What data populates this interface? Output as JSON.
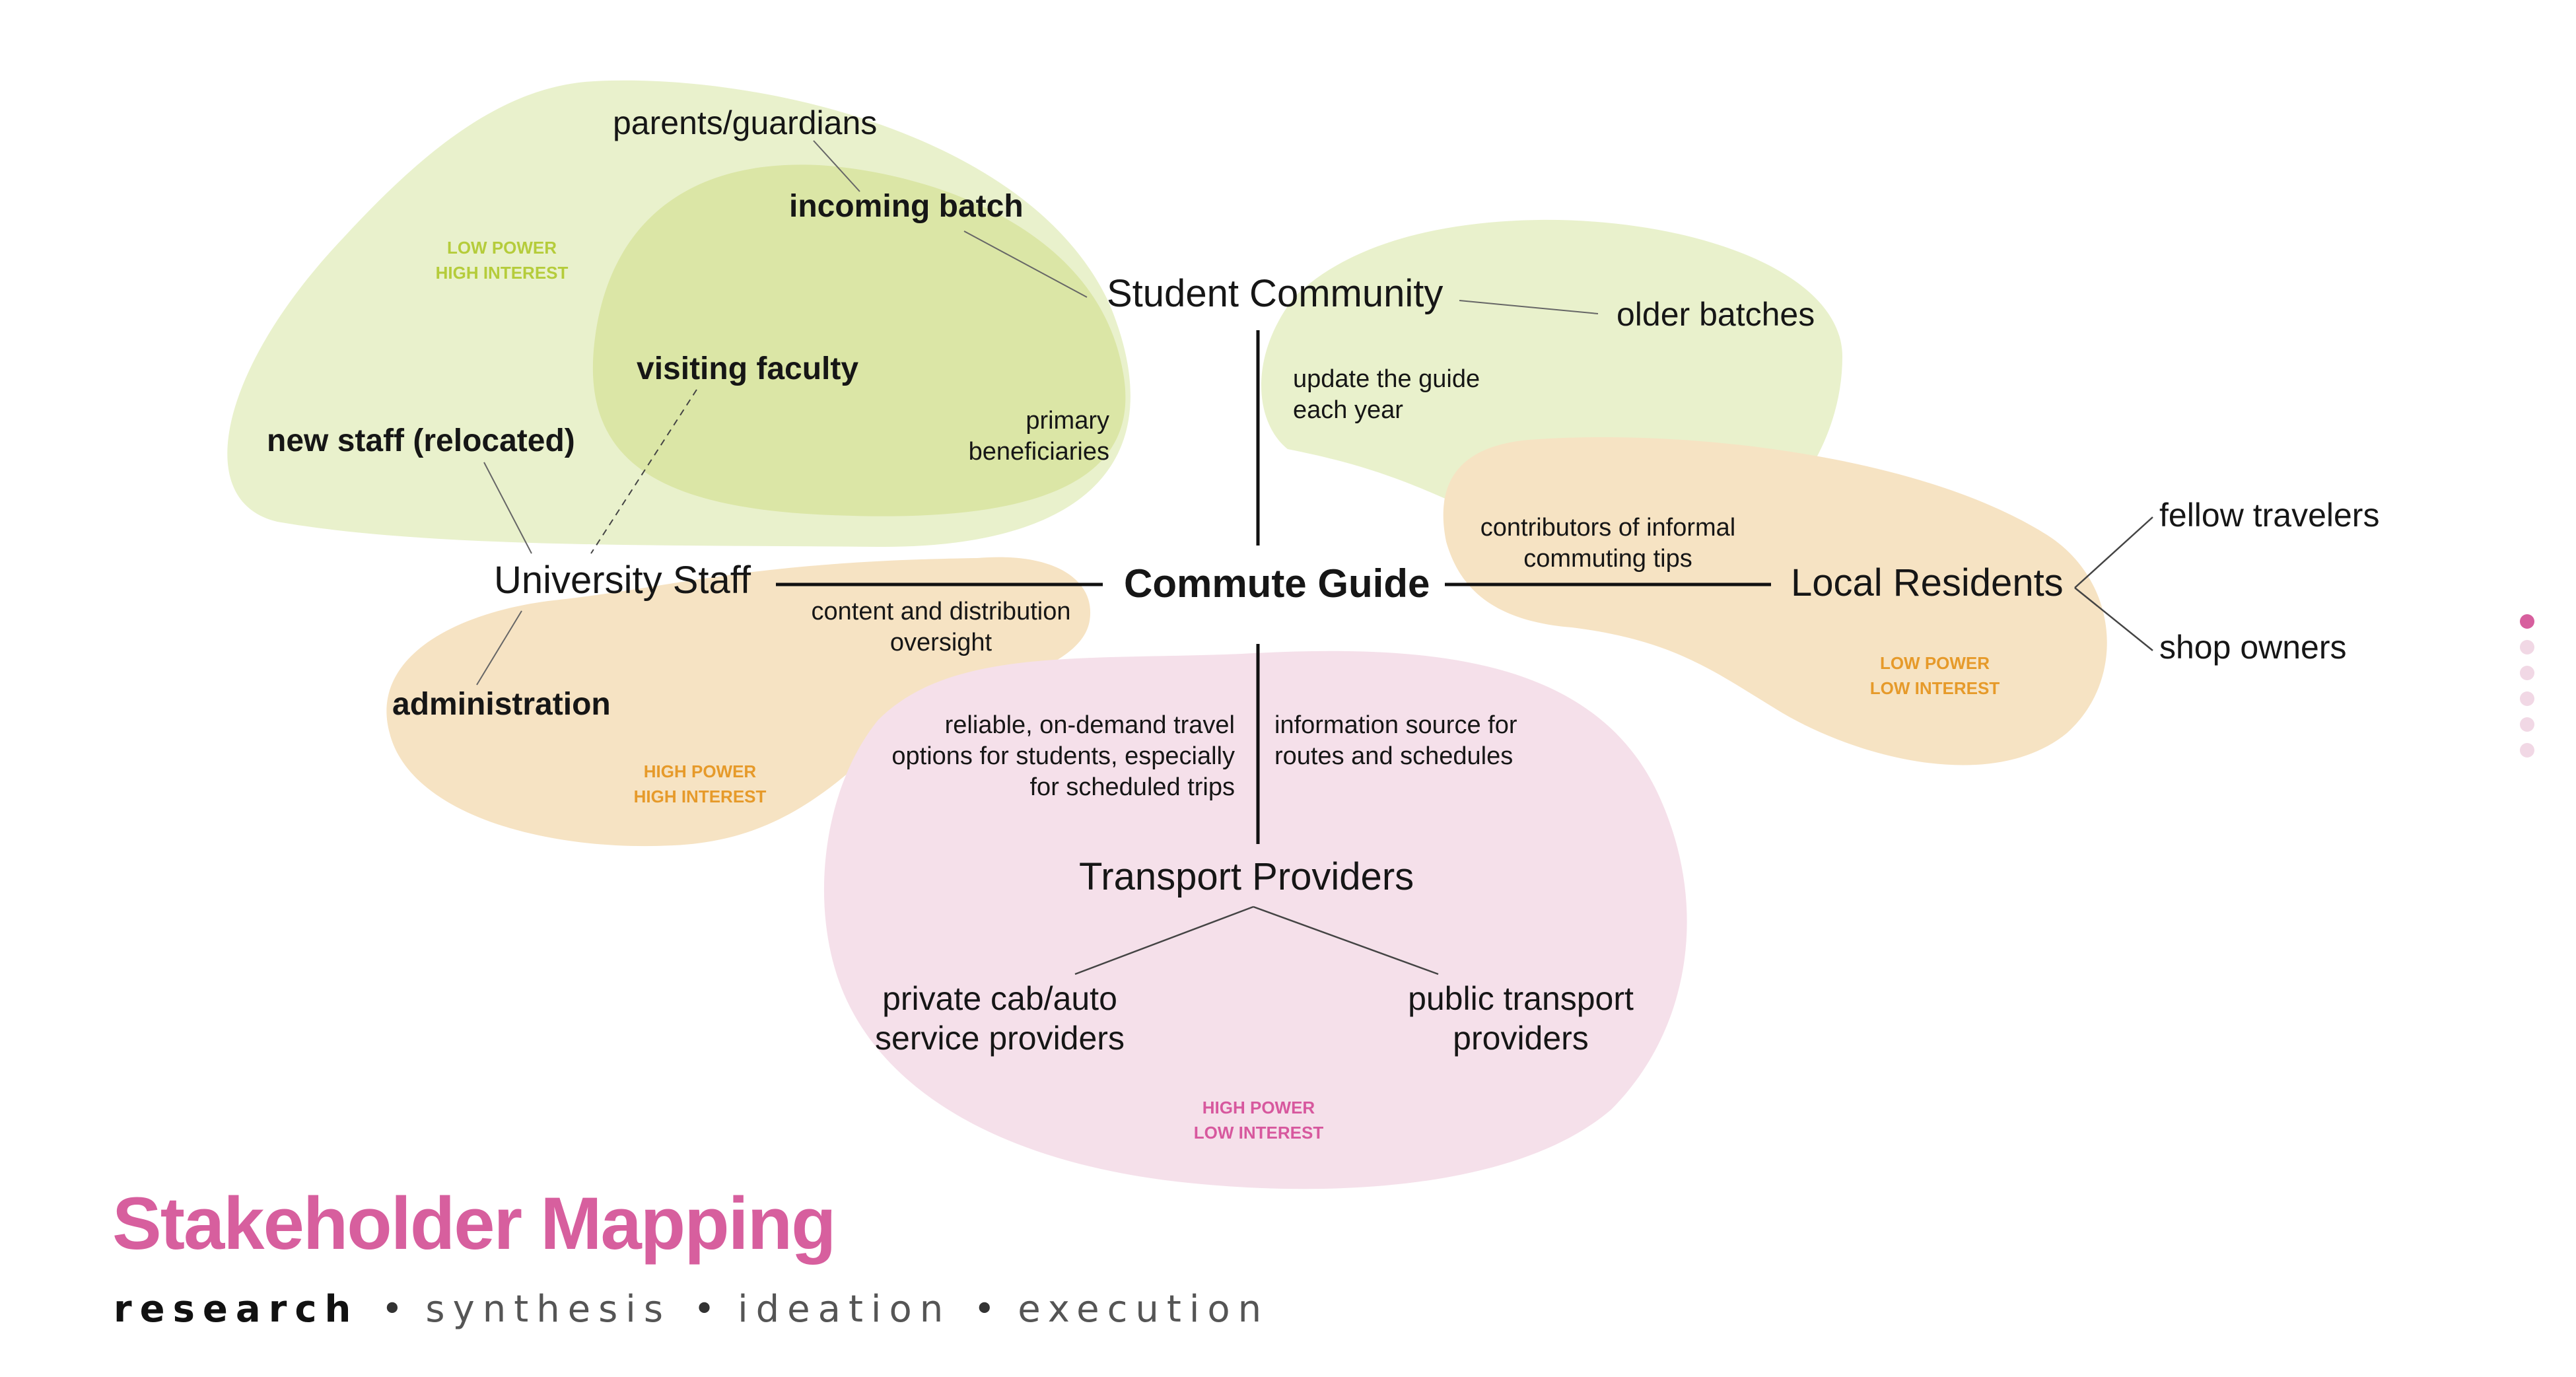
{
  "colors": {
    "green_light": "#e9f1cc",
    "green_mid": "#dbe6a6",
    "orange_light": "#f6e3c3",
    "pink_light": "#f5e0ea",
    "green_tag": "#b5cc3b",
    "orange_tag": "#e69a2a",
    "pink_tag": "#d7589e",
    "title": "#d75f9e",
    "dot_active": "#d75f9e",
    "dot_inactive": "#f1d8e5",
    "line": "#111111",
    "leader": "#666666"
  },
  "diagram": {
    "center": "Commute Guide",
    "nodes": {
      "student_community": "Student Community",
      "university_staff": "University Staff",
      "local_residents": "Local Residents",
      "transport_providers": "Transport Providers"
    },
    "sub_nodes": {
      "parents_guardians": "parents/guardians",
      "incoming_batch": "incoming batch",
      "visiting_faculty": "visiting faculty",
      "new_staff": "new staff (relocated)",
      "administration": "administration",
      "older_batches": "older batches",
      "fellow_travelers": "fellow travelers",
      "shop_owners": "shop owners",
      "private_cab": [
        "private cab/auto",
        "service providers"
      ],
      "public_transport": [
        "public transport",
        "providers"
      ]
    },
    "notes": {
      "primary_beneficiaries": [
        "primary",
        "beneficiaries"
      ],
      "update_guide": [
        "update the guide",
        "each year"
      ],
      "contributors": [
        "contributors of informal",
        "commuting tips"
      ],
      "content_oversight": [
        "content and distribution",
        "oversight"
      ],
      "reliable_options": [
        "reliable, on-demand travel",
        "options for students, especially",
        "for scheduled trips"
      ],
      "information_source": [
        "information source for",
        "routes and schedules"
      ]
    },
    "tags": {
      "student": [
        "LOW POWER",
        "HIGH INTEREST"
      ],
      "staff": [
        "HIGH POWER",
        "HIGH INTEREST"
      ],
      "residents": [
        "LOW POWER",
        "LOW INTEREST"
      ],
      "transport": [
        "HIGH POWER",
        "LOW INTEREST"
      ]
    }
  },
  "page": {
    "title": "Stakeholder Mapping",
    "nav": [
      "research",
      "synthesis",
      "ideation",
      "execution"
    ],
    "active_step": "research",
    "separator": "•",
    "pager_dots": 6,
    "pager_active_index": 0
  }
}
